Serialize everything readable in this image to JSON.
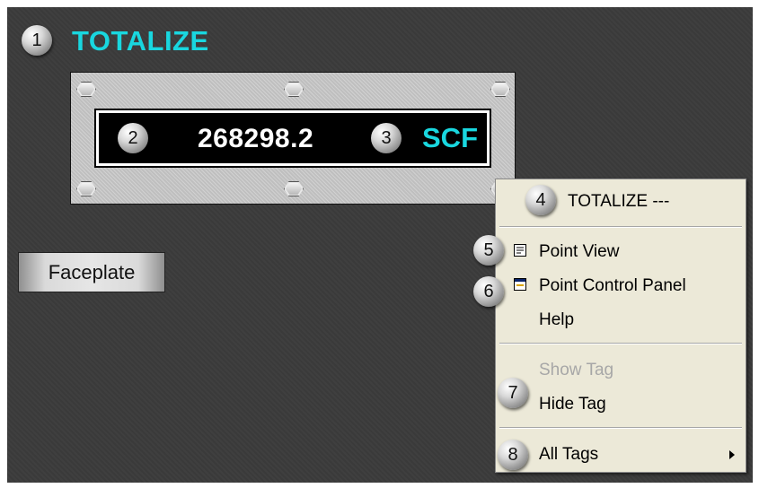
{
  "markers": [
    "1",
    "2",
    "3",
    "4",
    "5",
    "6",
    "7",
    "8"
  ],
  "title": "TOTALIZE",
  "display": {
    "value": "268298.2",
    "units": "SCF"
  },
  "faceplate_button": "Faceplate",
  "context_menu": {
    "header": "TOTALIZE ---",
    "items": [
      {
        "label": "Point View",
        "icon": "point-view-icon",
        "enabled": true
      },
      {
        "label": "Point Control Panel",
        "icon": "control-panel-icon",
        "enabled": true
      },
      {
        "label": "Help",
        "enabled": true
      },
      {
        "label": "Show Tag",
        "enabled": false
      },
      {
        "label": "Hide Tag",
        "enabled": true
      },
      {
        "label": "All Tags",
        "submenu": true,
        "enabled": true
      }
    ]
  },
  "colors": {
    "accent": "#19d7df",
    "panel": "#3b3b3b",
    "menu_bg": "#ece9d8"
  }
}
